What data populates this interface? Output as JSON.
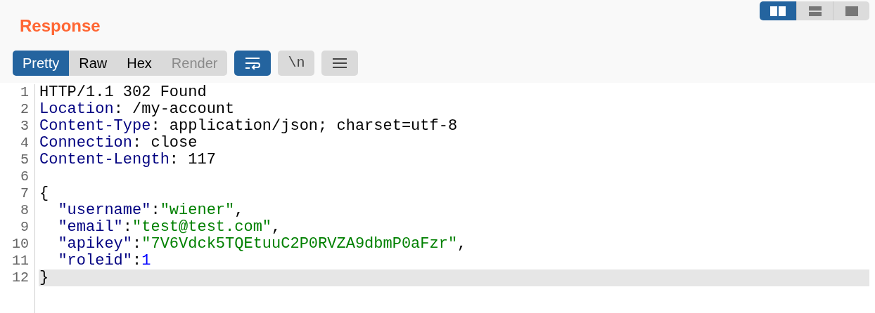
{
  "layout_buttons": [
    {
      "kind": "side",
      "selected": true
    },
    {
      "kind": "stacked",
      "selected": false
    },
    {
      "kind": "single",
      "selected": false
    }
  ],
  "title": "Response",
  "tabs": [
    {
      "label": "Pretty",
      "selected": true,
      "disabled": false
    },
    {
      "label": "Raw",
      "selected": false,
      "disabled": false
    },
    {
      "label": "Hex",
      "selected": false,
      "disabled": false
    },
    {
      "label": "Render",
      "selected": false,
      "disabled": true
    }
  ],
  "toggles": [
    {
      "kind": "wrap",
      "on": true
    },
    {
      "kind": "newline",
      "label": "\\n",
      "on": false
    },
    {
      "kind": "menu",
      "on": false
    }
  ],
  "lines": [
    {
      "number": "1",
      "selected": false,
      "tokens": [
        {
          "kind": "text",
          "text": "HTTP/1.1 302 Found"
        }
      ]
    },
    {
      "number": "2",
      "selected": false,
      "tokens": [
        {
          "kind": "key",
          "text": "Location"
        },
        {
          "kind": "text",
          "text": ": /my-account"
        }
      ]
    },
    {
      "number": "3",
      "selected": false,
      "tokens": [
        {
          "kind": "key",
          "text": "Content-Type"
        },
        {
          "kind": "text",
          "text": ": application/json; charset=utf-8"
        }
      ]
    },
    {
      "number": "4",
      "selected": false,
      "tokens": [
        {
          "kind": "key",
          "text": "Connection"
        },
        {
          "kind": "text",
          "text": ": close"
        }
      ]
    },
    {
      "number": "5",
      "selected": false,
      "tokens": [
        {
          "kind": "key",
          "text": "Content-Length"
        },
        {
          "kind": "text",
          "text": ": 117"
        }
      ]
    },
    {
      "number": "6",
      "selected": false
    },
    {
      "number": "7",
      "selected": false,
      "tokens": [
        {
          "kind": "text",
          "text": "{"
        }
      ]
    },
    {
      "number": "8",
      "selected": false,
      "tokens": [
        {
          "kind": "key",
          "text": "  \"username\""
        },
        {
          "kind": "text",
          "text": ":"
        },
        {
          "kind": "string",
          "text": "\"wiener\""
        },
        {
          "kind": "text",
          "text": ","
        }
      ]
    },
    {
      "number": "9",
      "selected": false,
      "tokens": [
        {
          "kind": "key",
          "text": "  \"email\""
        },
        {
          "kind": "text",
          "text": ":"
        },
        {
          "kind": "string",
          "text": "\"test@test.com\""
        },
        {
          "kind": "text",
          "text": ","
        }
      ]
    },
    {
      "number": "10",
      "selected": false,
      "tokens": [
        {
          "kind": "key",
          "text": "  \"apikey\""
        },
        {
          "kind": "text",
          "text": ":"
        },
        {
          "kind": "string",
          "text": "\"7V6Vdck5TQEtuuC2P0RVZA9dbmP0aFzr\""
        },
        {
          "kind": "text",
          "text": ","
        }
      ]
    },
    {
      "number": "11",
      "selected": false,
      "tokens": [
        {
          "kind": "key",
          "text": "  \"roleid\""
        },
        {
          "kind": "text",
          "text": ":"
        },
        {
          "kind": "number",
          "text": "1"
        }
      ]
    },
    {
      "number": "12",
      "selected": true,
      "tokens": [
        {
          "kind": "text",
          "text": "}"
        }
      ]
    }
  ]
}
